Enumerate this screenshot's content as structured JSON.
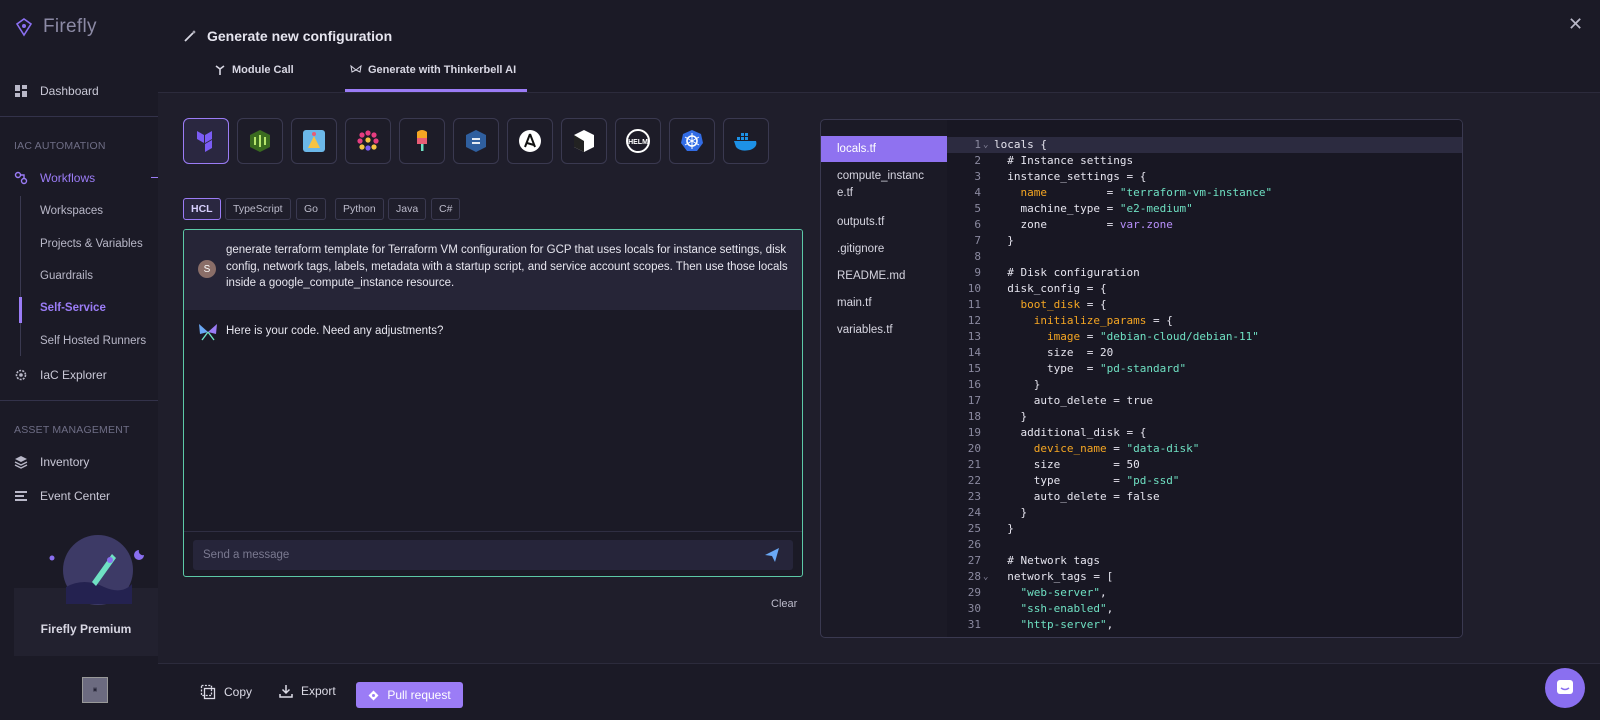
{
  "app": {
    "name": "Firefly"
  },
  "sidebar": {
    "dashboard": "Dashboard",
    "iac_section": "IAC AUTOMATION",
    "workflows": "Workflows",
    "workflow_items": [
      "Workspaces",
      "Projects & Variables",
      "Guardrails",
      "Self-Service",
      "Self Hosted Runners"
    ],
    "active_item": "Self-Service",
    "iac_explorer": "IaC Explorer",
    "asset_section": "ASSET MANAGEMENT",
    "inventory": "Inventory",
    "event_center": "Event Center",
    "premium": "Firefly Premium"
  },
  "header": {
    "title": "Generate new configuration",
    "tabs": [
      {
        "label": "Module Call",
        "active": false
      },
      {
        "label": "Generate with Thinkerbell AI",
        "active": true
      }
    ]
  },
  "tools": [
    "terraform-icon",
    "opentofu-icon",
    "pulumi-icon",
    "crossplane-icon",
    "popsicle-icon",
    "config-tool-icon",
    "ansible-icon",
    "cloudformation-icon",
    "helm-icon",
    "kubernetes-icon",
    "docker-icon"
  ],
  "languages": [
    {
      "label": "HCL",
      "active": true
    },
    {
      "label": "TypeScript",
      "active": false
    },
    {
      "label": "Go",
      "active": false
    },
    {
      "label": "Python",
      "active": false
    },
    {
      "label": "Java",
      "active": false
    },
    {
      "label": "C#",
      "active": false
    }
  ],
  "chat": {
    "user_initial": "S",
    "user_message": "generate terraform template for Terraform VM configuration for GCP that uses locals for instance settings, disk config, network tags, labels, metadata with a startup script, and service account scopes. Then use those locals inside a google_compute_instance resource.",
    "bot_message": "Here is your code. Need any adjustments?",
    "input_placeholder": "Send a message",
    "clear_label": "Clear"
  },
  "files": [
    "locals.tf",
    "compute_instanc e.tf",
    "outputs.tf",
    ".gitignore",
    "README.md",
    "main.tf",
    "variables.tf"
  ],
  "active_file": "locals.tf",
  "code_lines": [
    "locals {",
    "  # Instance settings",
    "  instance_settings = {",
    "    name         = \"terraform-vm-instance\"",
    "    machine_type = \"e2-medium\"",
    "    zone         = var.zone",
    "  }",
    "",
    "  # Disk configuration",
    "  disk_config = {",
    "    boot_disk = {",
    "      initialize_params = {",
    "        image = \"debian-cloud/debian-11\"",
    "        size  = 20",
    "        type  = \"pd-standard\"",
    "      }",
    "      auto_delete = true",
    "    }",
    "    additional_disk = {",
    "      device_name = \"data-disk\"",
    "      size        = 50",
    "      type        = \"pd-ssd\"",
    "      auto_delete = false",
    "    }",
    "  }",
    "",
    "  # Network tags",
    "  network_tags = [",
    "    \"web-server\",",
    "    \"ssh-enabled\",",
    "    \"http-server\","
  ],
  "footer": {
    "copy": "Copy",
    "export": "Export",
    "pull_request": "Pull request"
  },
  "colors": {
    "accent": "#9b7cf6",
    "teal": "#5cc9a7",
    "string": "#6fe1c3",
    "key_orange": "#f5a623"
  }
}
